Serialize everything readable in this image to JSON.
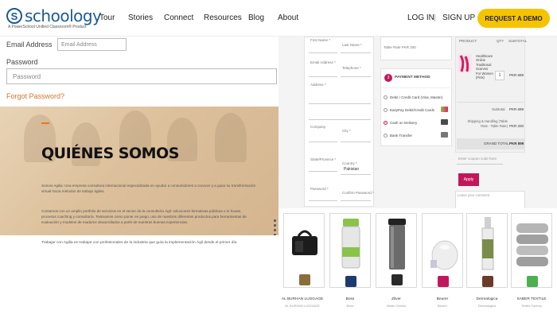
{
  "header": {
    "logo_letter": "S",
    "logo_text": "schoology",
    "logo_sub": "A PowerSchool Unified Classroom® Product",
    "nav": [
      "Tour",
      "Stories",
      "Connect",
      "Resources",
      "Blog",
      "About"
    ],
    "login": "LOG IN",
    "separator": "|",
    "signup": "SIGN UP",
    "demo": "REQUEST A DEMO",
    "colors": {
      "brand": "#1a5a96",
      "demo_button": "#f5c400"
    }
  },
  "login_form": {
    "email_label": "Email Address",
    "email_placeholder": "Email Address",
    "password_label": "Password",
    "password_placeholder": "Password",
    "forgot": "Forgot Password?"
  },
  "about": {
    "title": "QUIÉNES SOMOS",
    "p1": "Somos Agilia: Una empresa consultora internacional especializada en ayudar a consumidores a conocer y a guiar su transformación virtual hacia métodos de trabajo ágiles.",
    "p2": "Contamos con un amplio portfolio de servicios en el sector de la consultoría Ágil: soluciones formativas públicas o in house, procesos coaching y consultoría. Testeamos como poner en juego, uso de nuestros diferentes productos para herramientas de evaluación y modelos de madurez desarrollados a partir de nuestras buenas experiencias.",
    "p3": "Trabajar con Agilia es trabajar con profesionales de la industria que guía la implementación Ágil desde el primer día"
  },
  "checkout": {
    "fields": {
      "first_name": "First Name *",
      "last_name": "Last Name *",
      "email": "Email Address *",
      "telephone": "Telephone *",
      "address": "Address *",
      "company": "Company",
      "city": "City *",
      "state": "State/Province *",
      "country": "Country *",
      "country_value": "Pakistan",
      "password": "Password *",
      "confirm_password": "Confirm Password *"
    },
    "table_rate": "Table Rate PKR 200",
    "payment_step": "3",
    "payment_title": "PAYMENT METHOD",
    "payment_options": [
      "Debit / Credit Card (Visa, Master)",
      "EasyPay Debit/Credit Cards",
      "Cash on Delivery",
      "Bank Transfer"
    ],
    "selected_payment_index": 2,
    "summary": {
      "col_product": "PRODUCT",
      "col_qty": "QTY",
      "col_subtotal": "SUBTOTAL",
      "item_name": "Healthicare Online Traditional Scarves For Women (Pink)",
      "item_qty": "1",
      "item_price": "PKR 699",
      "subtotal_label": "Subtotal",
      "subtotal_value": "PKR 699",
      "shipping_label": "Shipping & Handling (Table Rate - Table Rate)",
      "shipping_value": "PKR 200",
      "grand_label": "GRAND TOTAL",
      "grand_value": "PKR 899",
      "coupon_placeholder": "Enter coupon code here",
      "apply": "Apply",
      "comment_placeholder": "Leave your comment"
    },
    "accent": "#c2185b"
  },
  "products": [
    {
      "name": "AL BURHAN LUGGAGE",
      "brand": "AL BURHAN LUGGAGE",
      "icon": "bag-icon",
      "color": "#222222",
      "badge": "#8b6d3a"
    },
    {
      "name": "Boss",
      "brand": "Boss",
      "icon": "water-bottle-icon",
      "color": "#8bc34a",
      "badge": "#1e3a6e"
    },
    {
      "name": "Zilver",
      "brand": "Water Genius",
      "icon": "tumbler-icon",
      "color": "#555555",
      "badge": "#2a2a2a"
    },
    {
      "name": "Beurer",
      "brand": "Beurer",
      "icon": "diffuser-icon",
      "color": "#e0e0e0",
      "badge": "#c2185b"
    },
    {
      "name": "Dermalogica",
      "brand": "Dermalogica",
      "icon": "serum-bottle-icon",
      "color": "#7a8c4a",
      "badge": "#6b3b2a"
    },
    {
      "name": "SABER TEXTILE",
      "brand": "Textile Factory",
      "icon": "towels-icon",
      "color": "#9e9e9e",
      "badge": "#4caf50"
    }
  ]
}
